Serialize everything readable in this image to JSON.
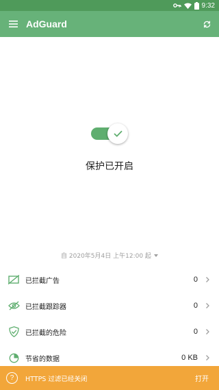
{
  "status_bar": {
    "time": "9:32",
    "icons": [
      "key-icon",
      "wifi-icon",
      "battery-icon"
    ]
  },
  "app_bar": {
    "title": "AdGuard",
    "menu_icon": "menu-icon",
    "refresh_icon": "refresh-icon"
  },
  "protection": {
    "status_text": "保护已开启",
    "enabled": true
  },
  "date_filter": {
    "label": "自 2020年5月4日 上午12:00 起"
  },
  "stats": [
    {
      "label": "已拦截广告",
      "value": "0",
      "icon": "ad-block-icon"
    },
    {
      "label": "已拦截跟踪器",
      "value": "0",
      "icon": "tracker-block-icon"
    },
    {
      "label": "已拦截的危险",
      "value": "0",
      "icon": "shield-check-icon"
    },
    {
      "label": "节省的数据",
      "value": "0 KB",
      "icon": "data-saved-icon"
    }
  ],
  "https_banner": {
    "text": "HTTPS 过滤已经关闭",
    "action": "打开",
    "icon": "?"
  },
  "colors": {
    "status_bar": "#4f9a5a",
    "app_bar": "#67b279",
    "accent": "#5fae6f",
    "banner": "#f2a63a"
  }
}
